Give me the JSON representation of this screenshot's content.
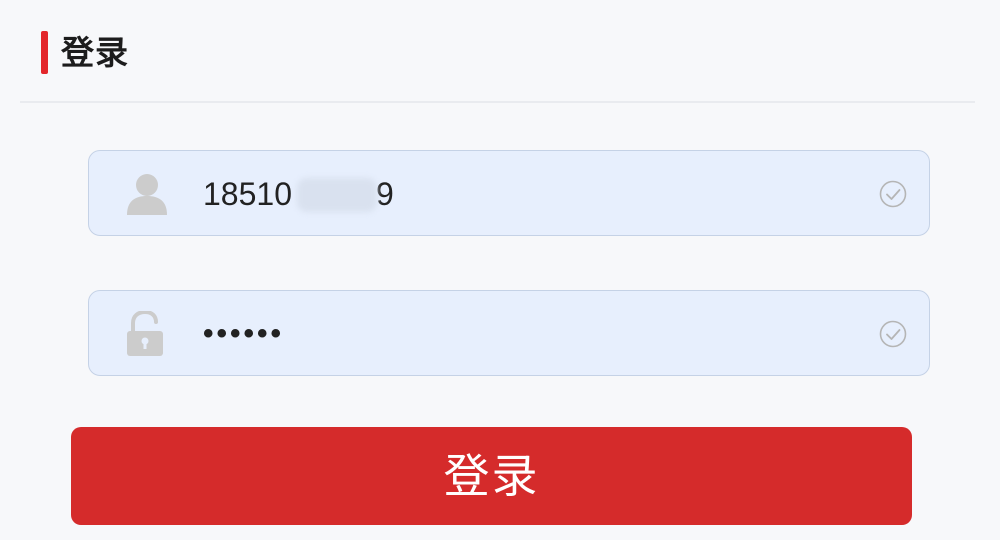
{
  "header": {
    "title": "登录"
  },
  "form": {
    "username": {
      "icon": "user-icon",
      "value_prefix": "18510",
      "value_suffix": "9",
      "status_icon": "check-circle-icon"
    },
    "password": {
      "icon": "unlock-icon",
      "value": "••••••",
      "status_icon": "check-circle-icon"
    }
  },
  "login_button": {
    "label": "登录"
  },
  "colors": {
    "accent": "#e3262b",
    "button": "#d52b2b",
    "field_bg": "#e7effd",
    "field_border": "#c5d2e6"
  }
}
